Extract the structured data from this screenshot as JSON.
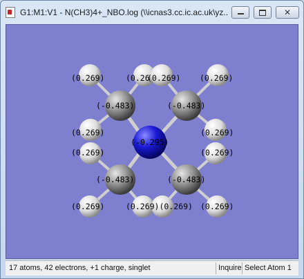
{
  "window": {
    "title": "G1:M1:V1 - N(CH3)4+_NBO.log (\\\\icnas3.cc.ic.ac.uk\\yz..."
  },
  "molecule": {
    "atoms": {
      "N": {
        "label": "-0.295",
        "color": "#1a1ad6"
      },
      "C": {
        "label": "-0.483",
        "color": "#8c8c8c"
      },
      "H": {
        "label": "0.269",
        "color": "#e8e8e8"
      }
    },
    "h_label_display": "(0.269)",
    "c_label_display": "(-0.483)",
    "n_label_display": "(-0.295)",
    "truncated_label": "(0.26",
    "overlap_label": "(0.269)(0.269)"
  },
  "colors": {
    "background": "#7f7fcf",
    "bond": "#d0d0d0"
  },
  "status": {
    "summary": "17 atoms, 42 electrons, +1 charge, singlet",
    "mode": "Inquire",
    "selection": "Select Atom 1"
  }
}
